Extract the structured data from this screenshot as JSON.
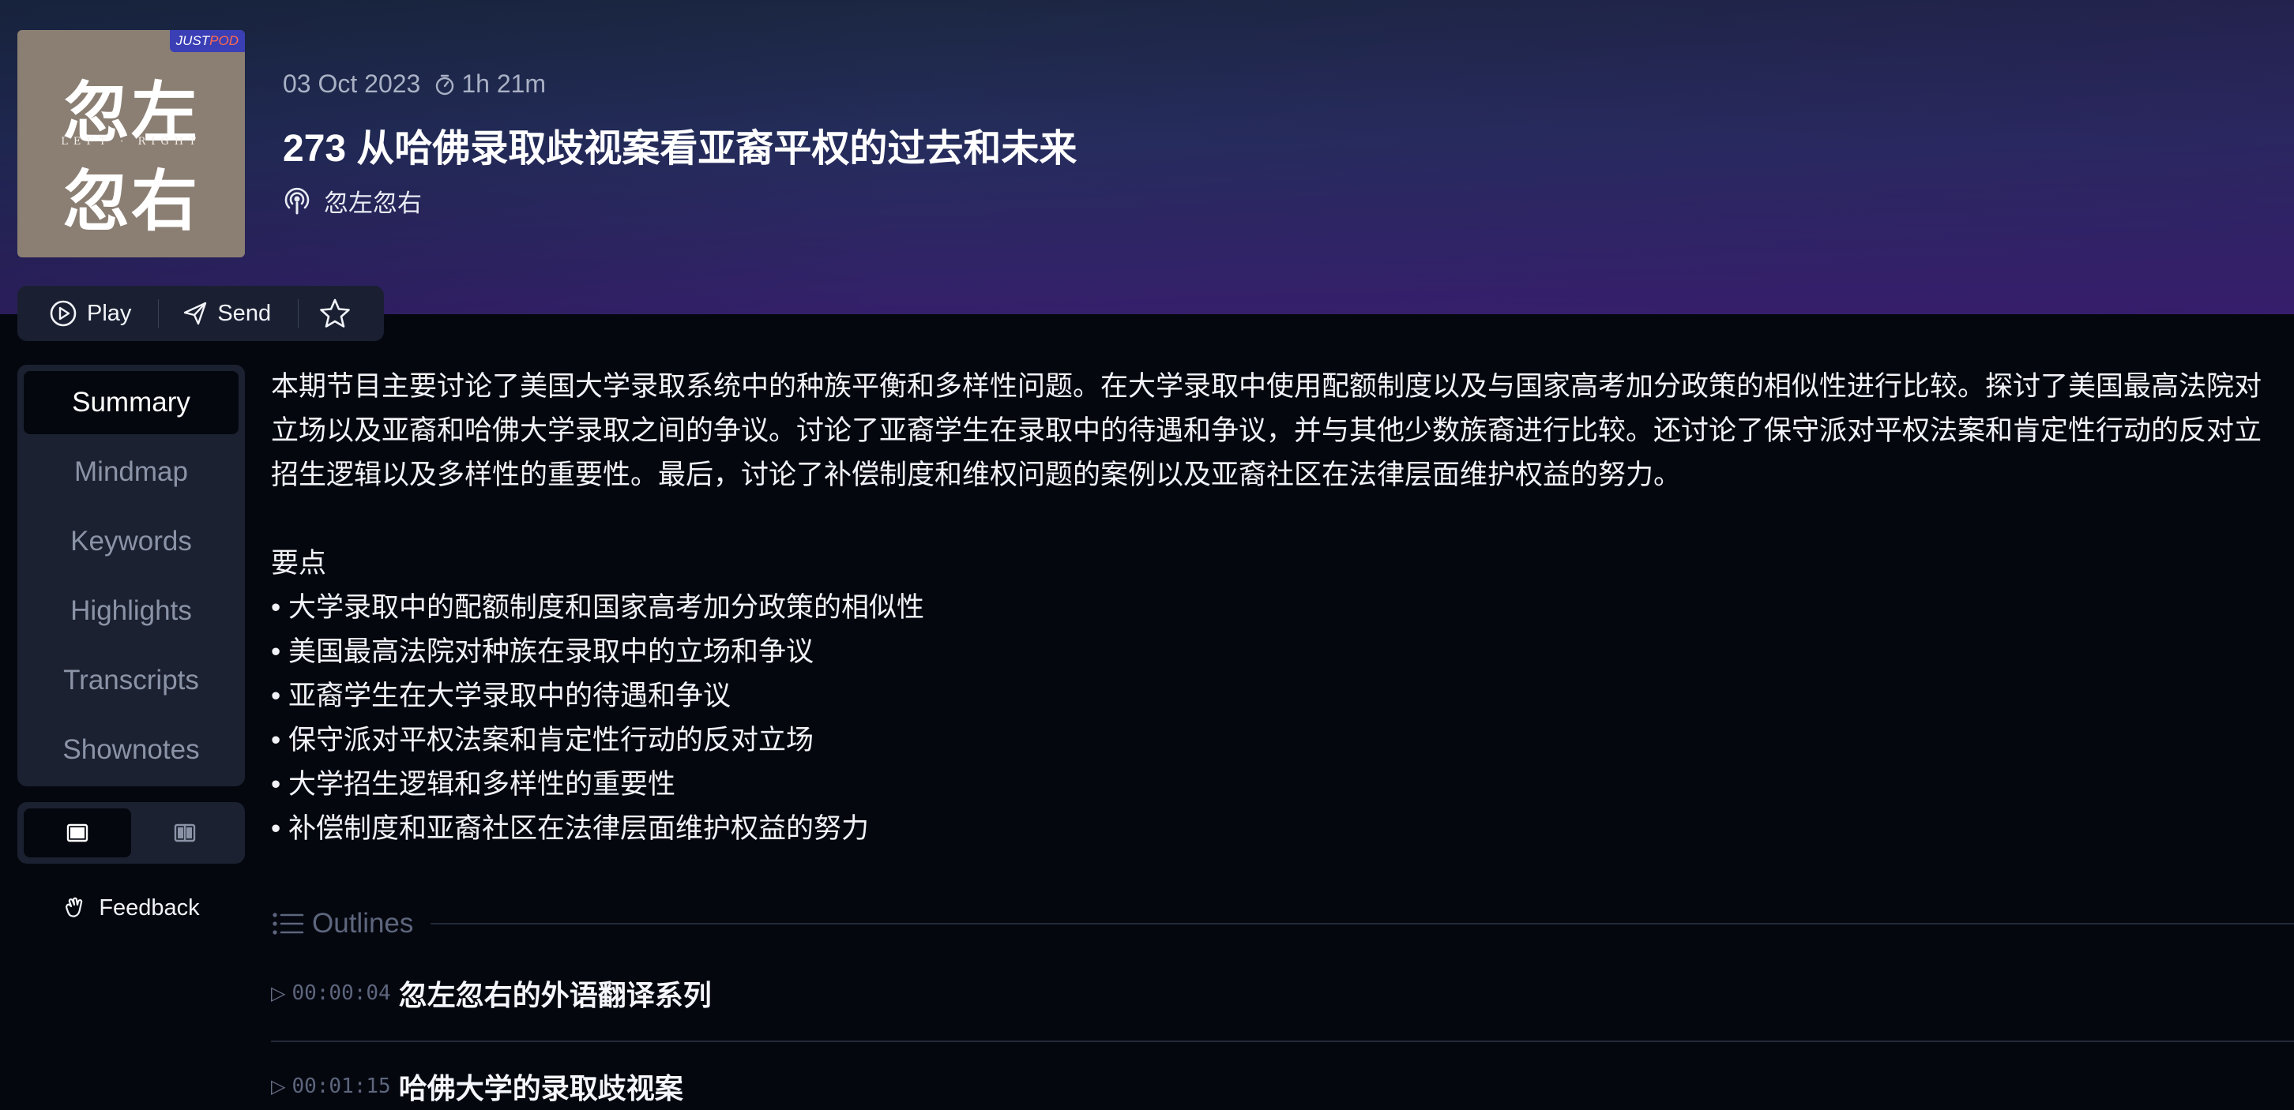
{
  "cover": {
    "badge_just": "JUST",
    "badge_pod": "POD",
    "line1": "忽左",
    "subtitle": "LEFT · RIGHT",
    "line2": "忽右"
  },
  "episode": {
    "date": "03 Oct 2023",
    "duration": "1h 21m",
    "title": "273 从哈佛录取歧视案看亚裔平权的过去和未来",
    "channel": "忽左忽右"
  },
  "actions": {
    "play": "Play",
    "send": "Send",
    "favorite_icon": "star-icon"
  },
  "nav": {
    "items": [
      "Summary",
      "Mindmap",
      "Keywords",
      "Highlights",
      "Transcripts",
      "Shownotes"
    ],
    "active": "Summary"
  },
  "view_toggle": {
    "options": [
      "single-column-icon",
      "two-column-icon"
    ],
    "active": "single-column-icon"
  },
  "feedback": {
    "label": "Feedback"
  },
  "summary": {
    "lines": [
      "本期节目主要讨论了美国大学录取系统中的种族平衡和多样性问题。在大学录取中使用配额制度以及与国家高考加分政策的相似性进行比较。探讨了美国最高法院对",
      "立场以及亚裔和哈佛大学录取之间的争议。讨论了亚裔学生在录取中的待遇和争议，并与其他少数族裔进行比较。还讨论了保守派对平权法案和肯定性行动的反对立",
      "招生逻辑以及多样性的重要性。最后，讨论了补偿制度和维权问题的案例以及亚裔社区在法律层面维护权益的努力。"
    ],
    "key_points_title": "要点",
    "key_points": [
      "大学录取中的配额制度和国家高考加分政策的相似性",
      "美国最高法院对种族在录取中的立场和争议",
      "亚裔学生在大学录取中的待遇和争议",
      "保守派对平权法案和肯定性行动的反对立场",
      "大学招生逻辑和多样性的重要性",
      "补偿制度和亚裔社区在法律层面维护权益的努力"
    ]
  },
  "outlines": {
    "label": "Outlines",
    "items": [
      {
        "time": "00:00:04",
        "title": "忽左忽右的外语翻译系列"
      },
      {
        "time": "00:01:15",
        "title": "哈佛大学的录取歧视案"
      }
    ]
  }
}
